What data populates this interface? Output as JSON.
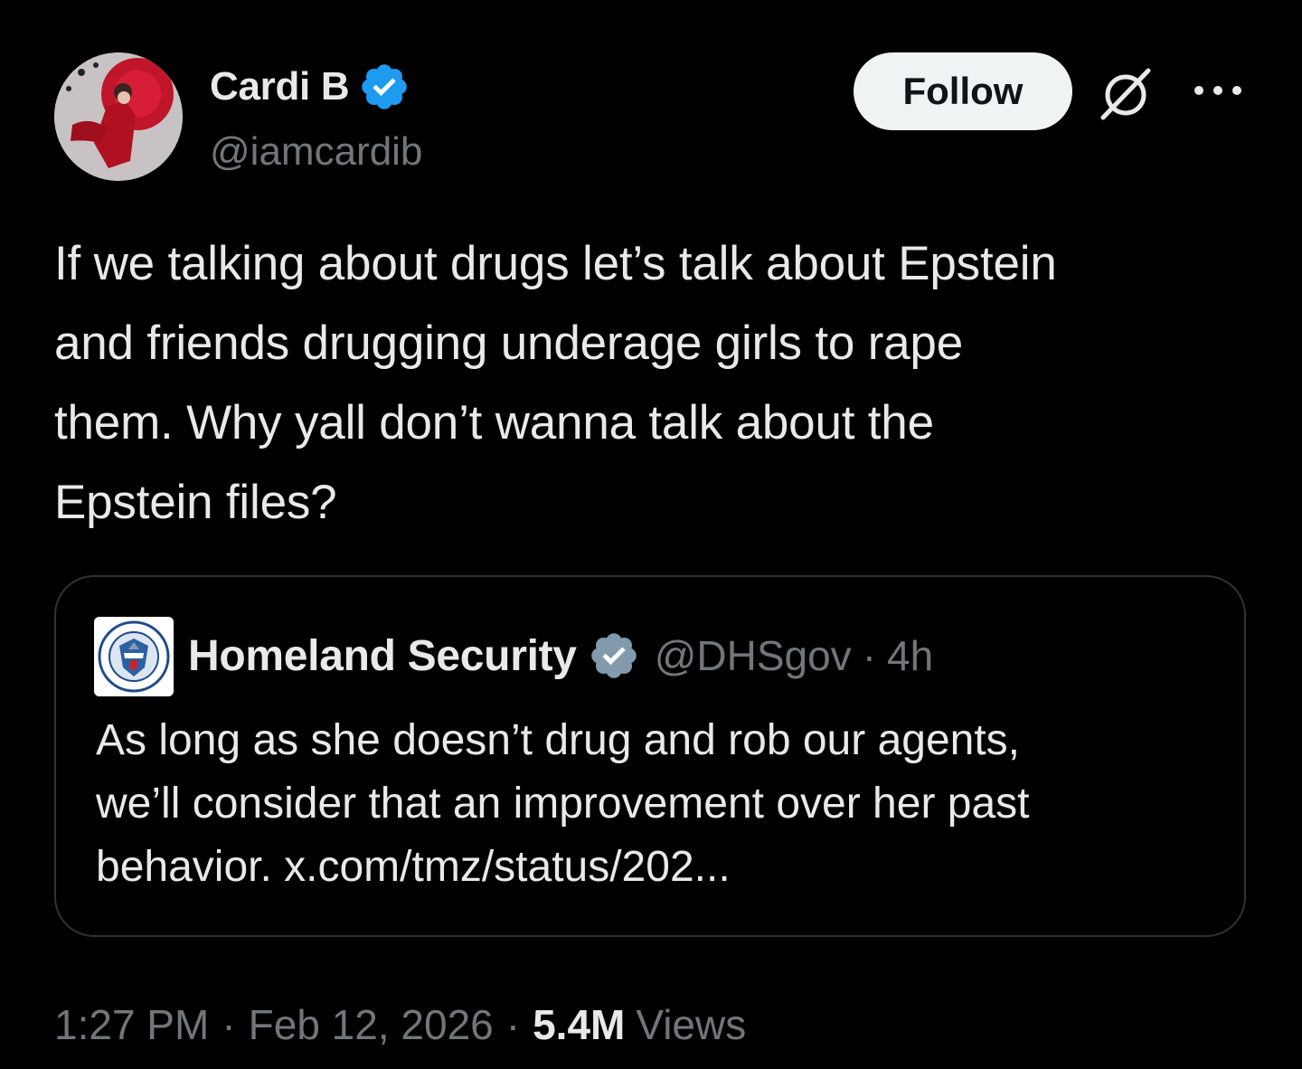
{
  "author": {
    "display_name": "Cardi B",
    "handle": "@iamcardib",
    "verified_badge": "blue-verified-icon",
    "verified_color": "#1d9bf0"
  },
  "header": {
    "follow_label": "Follow",
    "grok_icon": "grok-icon",
    "more_icon": "more-options-icon"
  },
  "tweet": {
    "text": "If we talking about drugs let’s talk about Epstein\nand friends drugging underage girls to rape\nthem. Why yall don’t wanna talk about the\nEpstein files?"
  },
  "quote": {
    "display_name": "Homeland Security",
    "verified_badge": "gray-verified-icon",
    "verified_color": "#829aab",
    "handle": "@DHSgov",
    "separator": "·",
    "time": "4h",
    "text": "As long as she doesn’t drug and rob our agents,\nwe’ll consider that an improvement over her past\nbehavior. x.com/tmz/status/202..."
  },
  "meta": {
    "time": "1:27 PM",
    "separator_1": "·",
    "date": "Feb 12, 2026",
    "separator_2": "·",
    "views_count": "5.4M",
    "views_label": "Views"
  },
  "colors": {
    "background": "#000000",
    "text_primary": "#e7e9ea",
    "text_secondary": "#71767b",
    "border": "#2f3336",
    "follow_bg": "#eff3f4"
  }
}
